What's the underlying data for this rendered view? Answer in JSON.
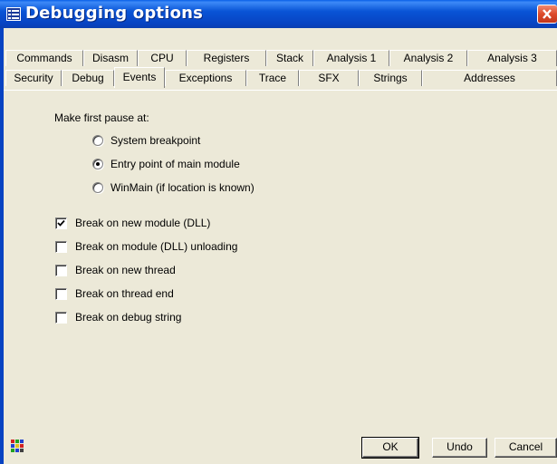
{
  "window": {
    "title": "Debugging options"
  },
  "tabs_row1": [
    "Commands",
    "Disasm",
    "CPU",
    "Registers",
    "Stack",
    "Analysis 1",
    "Analysis 2",
    "Analysis 3"
  ],
  "tabs_row2": [
    "Security",
    "Debug",
    "Events",
    "Exceptions",
    "Trace",
    "SFX",
    "Strings",
    "Addresses"
  ],
  "active_tab": "Events",
  "events": {
    "first_pause_label": "Make first pause at:",
    "radio_options": [
      {
        "label": "System breakpoint",
        "checked": false
      },
      {
        "label": "Entry point of main module",
        "checked": true
      },
      {
        "label": "WinMain (if location is known)",
        "checked": false
      }
    ],
    "checkboxes": [
      {
        "label": "Break on new module (DLL)",
        "checked": true
      },
      {
        "label": "Break on module (DLL) unloading",
        "checked": false
      },
      {
        "label": "Break on new thread",
        "checked": false
      },
      {
        "label": "Break on thread end",
        "checked": false
      },
      {
        "label": "Break on debug string",
        "checked": false
      }
    ]
  },
  "buttons": {
    "ok": "OK",
    "undo": "Undo",
    "cancel": "Cancel"
  },
  "colors": {
    "titlebar": "#0954d6",
    "close": "#dd4a2a",
    "face": "#ece9d8"
  }
}
